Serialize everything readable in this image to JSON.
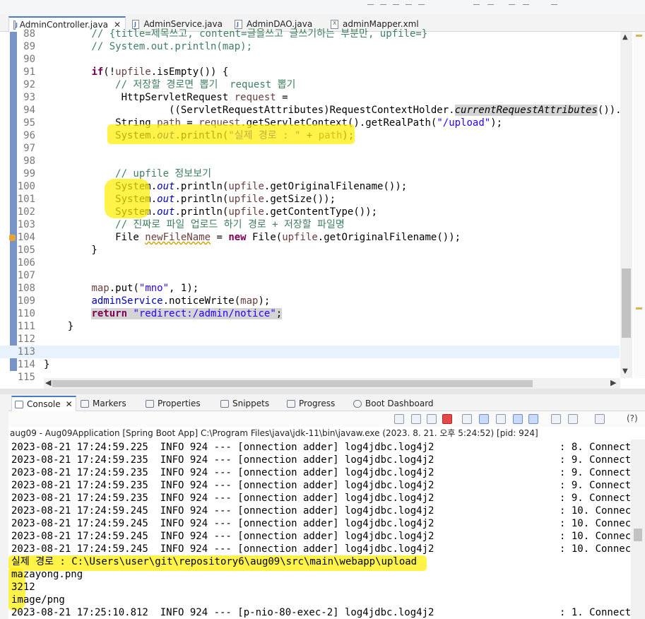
{
  "editor_tabs": [
    {
      "label": "AdminController.java",
      "icon": "java-file-icon",
      "active": true,
      "close": "✕"
    },
    {
      "label": "AdminService.java",
      "icon": "java-file-icon",
      "active": false
    },
    {
      "label": "AdminDAO.java",
      "icon": "java-file-icon",
      "active": false
    },
    {
      "label": "adminMapper.xml",
      "icon": "xml-file-icon",
      "active": false
    }
  ],
  "code_lines": [
    {
      "n": "88",
      "text": "        // {title=제목쓰고, content=글을쓰고 글쓰기하는 부분만, upfile=}"
    },
    {
      "n": "89",
      "text": "        // System.out.println(map);"
    },
    {
      "n": "90",
      "text": ""
    },
    {
      "n": "91",
      "text": "        if(!upfile.isEmpty()) {"
    },
    {
      "n": "92",
      "text": "            // 저장할 경로면 뽑기  request 뽑기"
    },
    {
      "n": "93",
      "text": "             HttpServletRequest request ="
    },
    {
      "n": "94",
      "text": "                     ((ServletRequestAttributes)RequestContextHolder.currentRequestAttributes()).g"
    },
    {
      "n": "95",
      "text": "            String path = request.getServletContext().getRealPath(\"/upload\");"
    },
    {
      "n": "96",
      "text": "            System.out.println(\"실제 경로 : \" + path);"
    },
    {
      "n": "97",
      "text": ""
    },
    {
      "n": "98",
      "text": ""
    },
    {
      "n": "99",
      "text": "            // upfile 정보보기"
    },
    {
      "n": "100",
      "text": "            System.out.println(upfile.getOriginalFilename());"
    },
    {
      "n": "101",
      "text": "            System.out.println(upfile.getSize());"
    },
    {
      "n": "102",
      "text": "            System.out.println(upfile.getContentType());"
    },
    {
      "n": "103",
      "text": "            // 진짜로 파일 업로드 하기 경로 + 저장할 파일명"
    },
    {
      "n": "104",
      "text": "            File newFileName = new File(upfile.getOriginalFilename());"
    },
    {
      "n": "105",
      "text": "        }"
    },
    {
      "n": "106",
      "text": ""
    },
    {
      "n": "107",
      "text": ""
    },
    {
      "n": "108",
      "text": "        map.put(\"mno\", 1);"
    },
    {
      "n": "109",
      "text": "        adminService.noticeWrite(map);"
    },
    {
      "n": "110",
      "text": "        return \"redirect:/admin/notice\";"
    },
    {
      "n": "111",
      "text": "    }"
    },
    {
      "n": "112",
      "text": ""
    },
    {
      "n": "113",
      "text": ""
    },
    {
      "n": "114",
      "text": "}"
    },
    {
      "n": "115",
      "text": ""
    }
  ],
  "console_tabs": [
    {
      "label": "Console",
      "icon": "console-icon",
      "active": true,
      "close": "✕"
    },
    {
      "label": "Markers",
      "icon": "markers-icon"
    },
    {
      "label": "Properties",
      "icon": "properties-icon"
    },
    {
      "label": "Snippets",
      "icon": "snippets-icon"
    },
    {
      "label": "Progress",
      "icon": "progress-icon"
    },
    {
      "label": "Boot Dashboard",
      "icon": "boot-dashboard-icon"
    }
  ],
  "console_description": "aug09 - Aug09Application [Spring Boot App] C:\\Program Files\\java\\jdk-11\\bin\\javaw.exe  (2023. 8. 21. 오후 5:24:52) [pid: 924]",
  "console_help": "(?)",
  "console_lines": [
    {
      "left": "2023-08-21 17:24:59.225  INFO 924 --- [onnection adder] log4jdbc.log4j2",
      "right": ": 8. Connect"
    },
    {
      "left": "2023-08-21 17:24:59.235  INFO 924 --- [onnection adder] log4jdbc.log4j2",
      "right": ": 9. Connect"
    },
    {
      "left": "2023-08-21 17:24:59.235  INFO 924 --- [onnection adder] log4jdbc.log4j2",
      "right": ": 9. Connect"
    },
    {
      "left": "2023-08-21 17:24:59.235  INFO 924 --- [onnection adder] log4jdbc.log4j2",
      "right": ": 9. Connect"
    },
    {
      "left": "2023-08-21 17:24:59.235  INFO 924 --- [onnection adder] log4jdbc.log4j2",
      "right": ": 9. Connect"
    },
    {
      "left": "2023-08-21 17:24:59.245  INFO 924 --- [onnection adder] log4jdbc.log4j2",
      "right": ": 10. Connec"
    },
    {
      "left": "2023-08-21 17:24:59.245  INFO 924 --- [onnection adder] log4jdbc.log4j2",
      "right": ": 10. Connec"
    },
    {
      "left": "2023-08-21 17:24:59.245  INFO 924 --- [onnection adder] log4jdbc.log4j2",
      "right": ": 10. Connec"
    },
    {
      "left": "2023-08-21 17:24:59.245  INFO 924 --- [onnection adder] log4jdbc.log4j2",
      "right": ": 10. Connec"
    },
    {
      "left": "실제 경로 : C:\\Users\\user\\git\\repository6\\aug09\\src\\main\\webapp\\upload",
      "right": ""
    },
    {
      "left": "mazayong.png",
      "right": ""
    },
    {
      "left": "3212",
      "right": ""
    },
    {
      "left": "image/png",
      "right": ""
    },
    {
      "left": "2023-08-21 17:25:10.812  INFO 924 --- [p-nio-80-exec-2] log4jdbc.log4j2",
      "right": ": 1. Connect"
    }
  ],
  "colors": {
    "keyword": "#7f0055",
    "comment": "#3f7f5f",
    "string": "#2a00ff",
    "field": "#0000c0",
    "highlighter": "#ffee00",
    "active_tab_accent": "#4a7cc5"
  }
}
